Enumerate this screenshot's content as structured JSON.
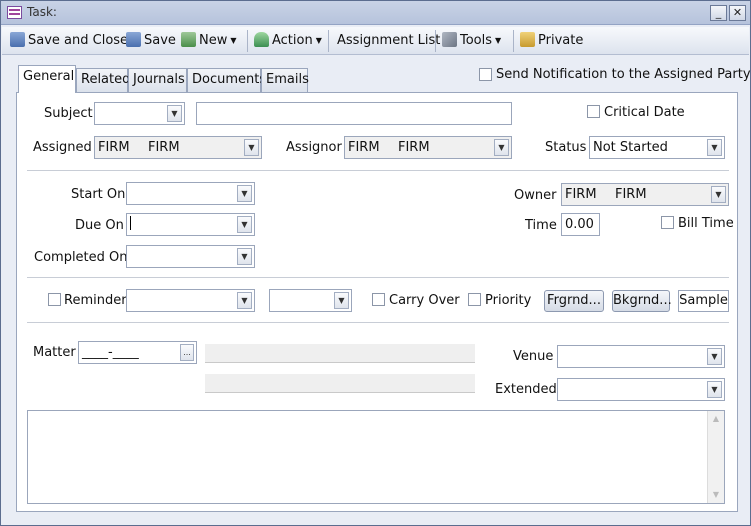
{
  "window": {
    "title": "Task:"
  },
  "toolbar": {
    "save_close": "Save and Close",
    "save": "Save",
    "new": "New",
    "action": "Action",
    "assignment_list": "Assignment List",
    "tools": "Tools",
    "private": "Private"
  },
  "tabs": [
    "General",
    "Related",
    "Journals",
    "Documents",
    "Emails"
  ],
  "notify_label": "Send Notification to the Assigned Party",
  "form": {
    "subject_label": "Subject",
    "subject_type_value": "",
    "subject_text_value": "",
    "critical_date_label": "Critical Date",
    "assigned_label": "Assigned",
    "assigned_code": "FIRM",
    "assigned_name": "FIRM",
    "assignor_label": "Assignor",
    "assignor_code": "FIRM",
    "assignor_name": "FIRM",
    "status_label": "Status",
    "status_value": "Not Started",
    "start_on_label": "Start On",
    "due_on_label": "Due On",
    "completed_on_label": "Completed On",
    "owner_label": "Owner",
    "owner_code": "FIRM",
    "owner_name": "FIRM",
    "time_label": "Time",
    "time_value": "0.00",
    "bill_time_label": "Bill Time",
    "reminder_label": "Reminder",
    "carry_over_label": "Carry Over",
    "priority_label": "Priority",
    "frgrnd_label": "Frgrnd...",
    "bkgrnd_label": "Bkgrnd...",
    "sample_label": "Sample",
    "matter_label": "Matter",
    "matter_value": "____-____",
    "matter_browse": "...",
    "venue_label": "Venue",
    "extended_label": "Extended"
  },
  "colors": {
    "accent": "#b6c3dc",
    "panel": "#ffffff",
    "frame": "#e9edf5"
  }
}
